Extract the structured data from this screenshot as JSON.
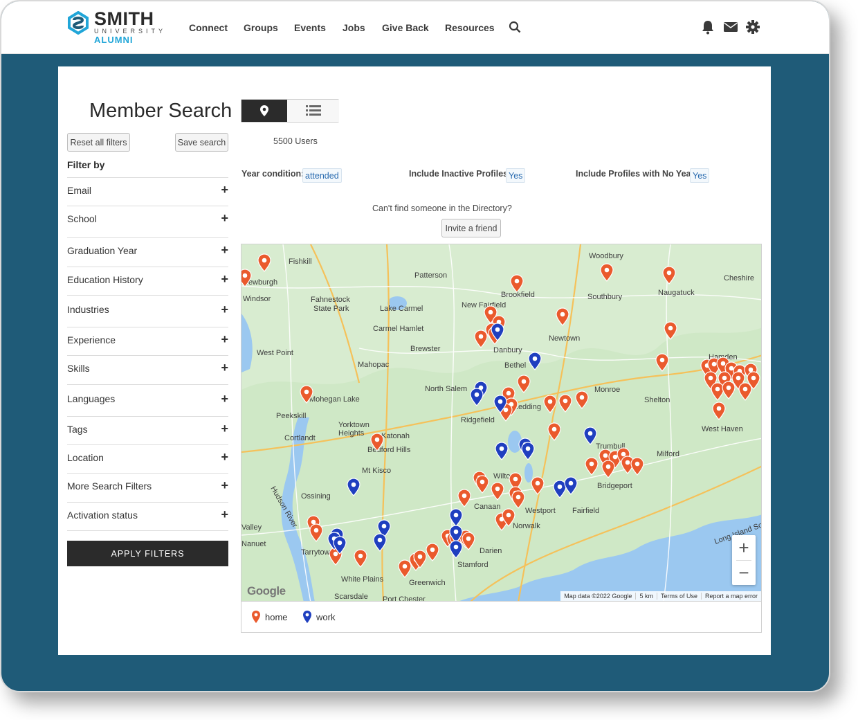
{
  "brand": {
    "title": "SMITH",
    "subtitle": "UNIVERSITY",
    "sub2": "ALUMNI",
    "accent": "#21a6d8"
  },
  "nav": {
    "items": [
      "Connect",
      "Groups",
      "Events",
      "Jobs",
      "Give Back",
      "Resources"
    ]
  },
  "sidebar": {
    "title": "Member Search",
    "reset_label": "Reset all filters",
    "save_label": "Save search",
    "filter_by": "Filter by",
    "filters": [
      "Email",
      "School",
      "Graduation Year",
      "Education History",
      "Industries",
      "Experience",
      "Skills",
      "Languages",
      "Tags",
      "Location",
      "More Search Filters",
      "Activation status"
    ],
    "apply_label": "APPLY FILTERS"
  },
  "results": {
    "user_count": "5500 Users",
    "year_condition_label": "Year condition:",
    "year_condition_value": "attended",
    "inactive_label": "Include Inactive Profiles:",
    "inactive_value": "Yes",
    "noyear_label": "Include Profiles with No Year:",
    "noyear_value": "Yes",
    "cant_find": "Can't find someone in the Directory?",
    "invite_label": "Invite a friend"
  },
  "map": {
    "place_labels": [
      "Woodbury",
      "Cheshire",
      "Fishkill",
      "Patterson",
      "Southbury",
      "Naugatuck",
      "Fahnestock",
      "State Park",
      "Lake Carmel",
      "New Fairfield",
      "Brookfield",
      "Carmel Hamlet",
      "Newtown",
      "Brewster",
      "Danbury",
      "West Point",
      "Mahopac",
      "Bethel",
      "Hamden",
      "North Salem",
      "Monroe",
      "Shelton",
      "Redding",
      "Ridgefield",
      "Yorktown",
      "Heights",
      "Katonah",
      "Peekskill",
      "Cortlandt",
      "Bedford Hills",
      "Trumbull",
      "Milford",
      "West Haven",
      "Mt Kisco",
      "Wilton",
      "Ossining",
      "Bridgeport",
      "Westport",
      "Fairfield",
      "Canaan",
      "Norwalk",
      "Darien",
      "Stamford",
      "Greenwich",
      "White Plains",
      "Scarsdale",
      "Port Chester",
      "Tarrytown",
      "Long Island Sound",
      "Hudson River",
      "Windsor",
      "Newburgh",
      "Mohegan Lake",
      "Valley",
      "Nanuet"
    ],
    "footer": [
      "Map data ©2022 Google",
      "5 km",
      "Terms of Use",
      "Report a map error"
    ],
    "google": "Google",
    "home_color": "#ea5a2d",
    "work_color": "#1f3fbf"
  },
  "legend": {
    "home": "home",
    "work": "work"
  }
}
